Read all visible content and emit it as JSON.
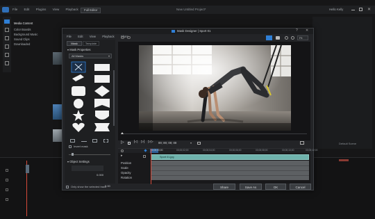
{
  "app": {
    "title": "New Untitled Project*",
    "menu": [
      "File",
      "Edit",
      "Plugins",
      "View",
      "Playback"
    ],
    "mode": "Full Editor",
    "user": "Hello Kelly",
    "media_tabs": [
      "Media Content",
      "Color Boards",
      "Background Music",
      "Sound Clips",
      "Downloaded"
    ],
    "right_button": "Default Scene"
  },
  "dialog": {
    "title": "Mask Designer | Sport 01",
    "menu": [
      "File",
      "Edit",
      "View",
      "Playback",
      "Share"
    ],
    "tabs": [
      "Mask",
      "Template"
    ],
    "section_mask": "Mask Properties",
    "dropdown_value": "All Masks",
    "invert_mask": "Invert mask",
    "section_object": "Object Settings",
    "value_a": "0.000",
    "value_b": "0.000",
    "value_c": "0.00",
    "value_d": "0.00",
    "only_selected": "Only show the selected track",
    "buttons": {
      "share": "Share",
      "save_as": "Save As",
      "ok": "OK",
      "cancel": "Cancel"
    },
    "timecode": "00; 00; 00; 00",
    "fit": "Fit",
    "clip_label": "Sport 01.jpg",
    "tracks": [
      "Position",
      "Scale",
      "Opacity",
      "Rotation"
    ],
    "ruler": [
      "00;00;00;00",
      "00;00;02;00",
      "00;00;04;00",
      "00;00;06;00",
      "00;00;08;00",
      "00;00;10;00",
      "00;00;12;00"
    ],
    "shapes": [
      "x",
      "rect",
      "diag",
      "rect2",
      "rounded",
      "diamond",
      "circle",
      "flag",
      "star",
      "shield",
      "heart",
      "banner"
    ]
  },
  "colors": {
    "accent_blue": "#2f7fd6",
    "clip_teal": "#6fb3ad",
    "playhead": "#d64a3a"
  }
}
